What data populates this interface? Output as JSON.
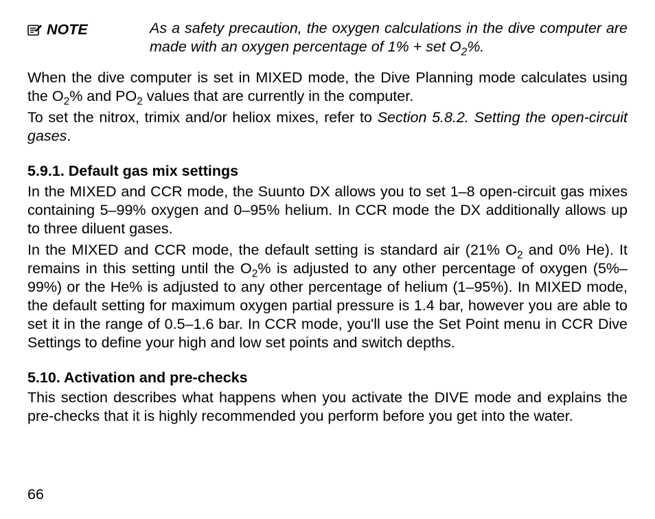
{
  "note": {
    "label": "NOTE",
    "body_pre": "As a safety precaution, the oxygen calculations in the dive computer are made with an oxygen percentage of 1% + set O",
    "body_sub": "2",
    "body_post": "%."
  },
  "intro": {
    "p1_a": "When the dive computer is set in MIXED mode, the Dive Planning mode calculates using the O",
    "p1_s1": "2",
    "p1_b": "% and PO",
    "p1_s2": "2",
    "p1_c": " values that are currently in the computer.",
    "p2_a": "To set the nitrox, trimix and/or heliox mixes, refer to ",
    "p2_ref": "Section 5.8.2. Setting the open-circuit gases",
    "p2_b": "."
  },
  "s591": {
    "heading": "5.9.1. Default gas mix settings",
    "p1": "In the MIXED and CCR mode, the Suunto DX allows you to set 1–8 open-circuit gas mixes containing 5–99% oxygen and 0–95% helium. In CCR mode the DX additionally allows up to three diluent gases.",
    "p2_a": "In the MIXED and CCR mode, the default setting is standard air (21% O",
    "p2_s1": "2",
    "p2_b": " and 0% He). It remains in this setting until the O",
    "p2_s2": "2",
    "p2_c": "% is adjusted to any other percentage of oxygen (5%–99%) or the He% is adjusted to any other percentage of helium (1–95%). In MIXED mode, the default setting for maximum oxygen partial pressure is 1.4 bar, however you are able to set it in the range of 0.5–1.6 bar. In CCR mode, you'll use the Set Point menu in CCR Dive Settings to define your high and low set points and switch depths."
  },
  "s510": {
    "heading": "5.10. Activation and pre-checks",
    "p1": "This section describes what happens when you activate the DIVE mode and explains the pre-checks that it is highly recommended you perform before you get into the water."
  },
  "page_number": "66"
}
